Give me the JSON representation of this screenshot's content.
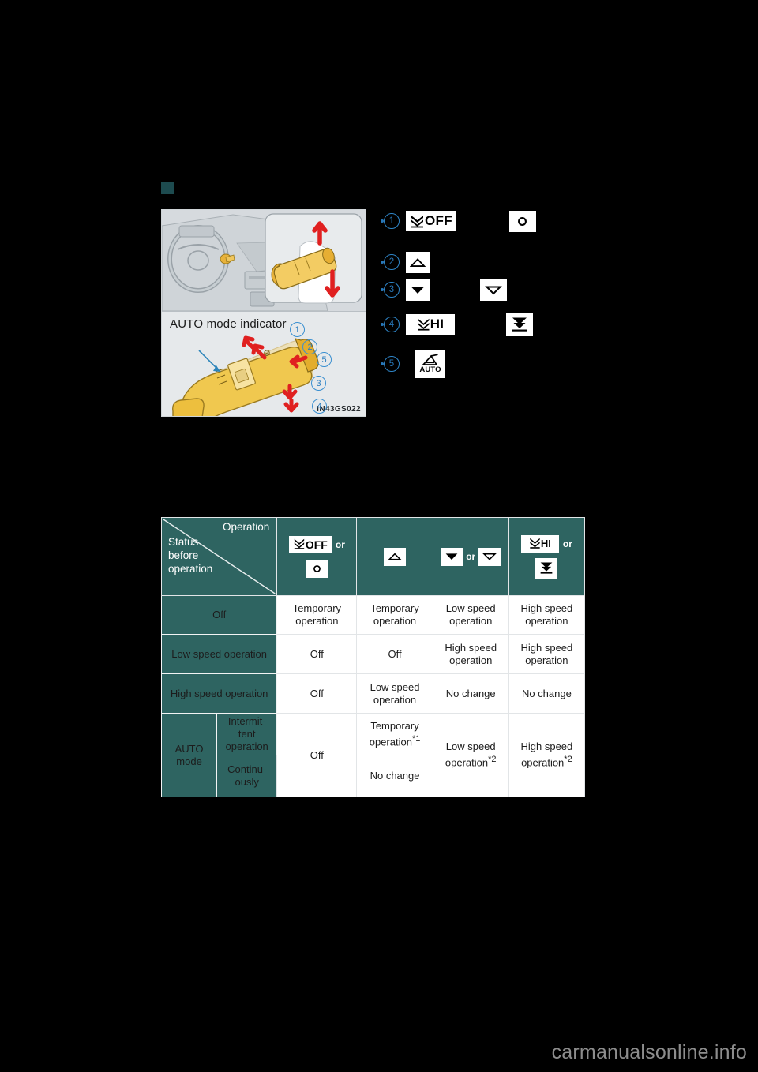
{
  "figure": {
    "caption_label": "AUTO mode indicator",
    "image_code": "IN43GS022",
    "callouts": [
      "1",
      "2",
      "5",
      "3",
      "4"
    ]
  },
  "legend": {
    "items": [
      {
        "num": "1",
        "primary_icon": "wiper-off-icon",
        "primary_text": "OFF",
        "secondary_icon": "dot-icon",
        "secondary_text": ""
      },
      {
        "num": "2",
        "primary_icon": "triangle-up-outline-icon",
        "primary_text": "",
        "secondary_icon": "",
        "secondary_text": ""
      },
      {
        "num": "3",
        "primary_icon": "triangle-down-filled-icon",
        "primary_text": "",
        "secondary_icon": "triangle-down-outline-icon",
        "secondary_text": ""
      },
      {
        "num": "4",
        "primary_icon": "wiper-hi-icon",
        "primary_text": "HI",
        "secondary_icon": "double-chevron-down-icon",
        "secondary_text": ""
      },
      {
        "num": "5",
        "primary_icon": "wiper-auto-icon",
        "primary_text": "AUTO",
        "secondary_icon": "",
        "secondary_text": ""
      }
    ]
  },
  "table": {
    "corner": {
      "operation_label": "Operation",
      "status_label": "Status\nbefore\noperation",
      "status_line1": "Status",
      "status_line2": "before",
      "status_line3": "operation"
    },
    "or_label": "or",
    "columns": [
      {
        "id": "col-off",
        "icons": [
          "wiper-off-icon",
          "dot-icon"
        ],
        "text": "OFF"
      },
      {
        "id": "col-up",
        "icons": [
          "triangle-up-outline-icon"
        ],
        "text": ""
      },
      {
        "id": "col-down",
        "icons": [
          "triangle-down-filled-icon",
          "triangle-down-outline-icon"
        ],
        "text": ""
      },
      {
        "id": "col-hi",
        "icons": [
          "wiper-hi-icon",
          "double-chevron-down-icon"
        ],
        "text": "HI"
      }
    ],
    "rows": [
      {
        "label": "Off",
        "cells": [
          "Temporary operation",
          "Temporary operation",
          "Low speed operation",
          "High speed operation"
        ]
      },
      {
        "label": "Low speed operation",
        "cells": [
          "Off",
          "Off",
          "High speed operation",
          "High speed operation"
        ]
      },
      {
        "label": "High speed operation",
        "cells": [
          "Off",
          "Low speed operation",
          "No change",
          "No change"
        ]
      }
    ],
    "auto_group": {
      "label": "AUTO mode",
      "label_line1": "AUTO",
      "label_line2": "mode",
      "sub_rows": [
        {
          "label_line1": "Intermit-",
          "label_line2": "tent",
          "label_line3": "operation",
          "cell_up": "Temporary operation",
          "cell_up_note": "*1"
        },
        {
          "label_line1": "Continu-",
          "label_line2": "ously",
          "label_line3": "",
          "cell_up": "No change",
          "cell_up_note": ""
        }
      ],
      "cell_off": "Off",
      "cell_down": "Low speed operation",
      "cell_down_note": "*2",
      "cell_hi": "High speed operation",
      "cell_hi_note": "*2"
    }
  },
  "watermark": {
    "text": "carmanualsonline.info"
  },
  "colors": {
    "teal": "#2e6461",
    "accent_blue": "#2877b8",
    "bullet": "#1d4b4f",
    "watermark": "#8d8d8d"
  }
}
